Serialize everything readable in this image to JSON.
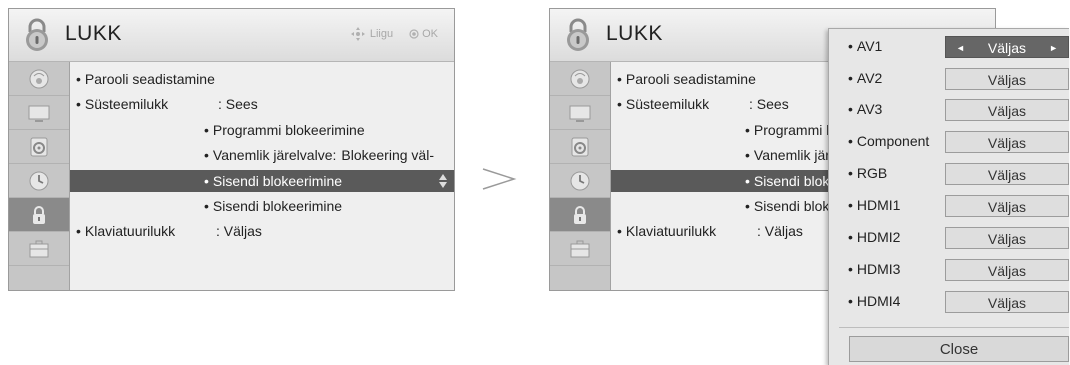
{
  "header": {
    "title": "LUKK",
    "hint_move": "Liigu",
    "hint_ok": "OK"
  },
  "sidebar": {
    "items": [
      {
        "icon": "satellite-dish-icon"
      },
      {
        "icon": "monitor-icon"
      },
      {
        "icon": "speaker-icon"
      },
      {
        "icon": "clock-icon"
      },
      {
        "icon": "lock-icon",
        "active": true
      },
      {
        "icon": "toolbox-icon"
      }
    ]
  },
  "menu": {
    "password": "Parooli seadistamine",
    "system_lock_label": "Süsteemilukk",
    "system_lock_value": ": Sees",
    "program_block": "Programmi blokeerimine",
    "parental_label": "Vanemlik järelvalve:",
    "parental_value": "Blokeering väl-",
    "input_block_selected": "Sisendi blokeerimine",
    "input_block": "Sisendi blokeerimine",
    "keyboard_lock_label": "Klaviatuurilukk",
    "keyboard_lock_value": ": Väljas"
  },
  "right_menu": {
    "password": "Parooli seadistamine",
    "system_lock_label": "Süsteemilukk",
    "system_lock_value": ": Sees",
    "program_block": "Programmi b",
    "parental": "Vanemlik jär",
    "input_block_selected": "Sisendi blokee",
    "input_block": "Sisendi blokee",
    "keyboard_lock_label": "Klaviatuurilukk",
    "keyboard_lock_value": ": Väljas"
  },
  "popup": {
    "items": [
      {
        "label": "AV1",
        "value": "Väljas",
        "selected": true
      },
      {
        "label": "AV2",
        "value": "Väljas"
      },
      {
        "label": "AV3",
        "value": "Väljas"
      },
      {
        "label": "Component",
        "value": "Väljas"
      },
      {
        "label": "RGB",
        "value": "Väljas"
      },
      {
        "label": "HDMI1",
        "value": "Väljas"
      },
      {
        "label": "HDMI2",
        "value": "Väljas"
      },
      {
        "label": "HDMI3",
        "value": "Väljas"
      },
      {
        "label": "HDMI4",
        "value": "Väljas"
      }
    ],
    "close_label": "Close",
    "arrow_left": "◄",
    "arrow_right": "►"
  },
  "colors": {
    "highlight": "#5a5a5a",
    "sidebar_active": "#8a8a8a",
    "menu_bg": "#efefef"
  }
}
